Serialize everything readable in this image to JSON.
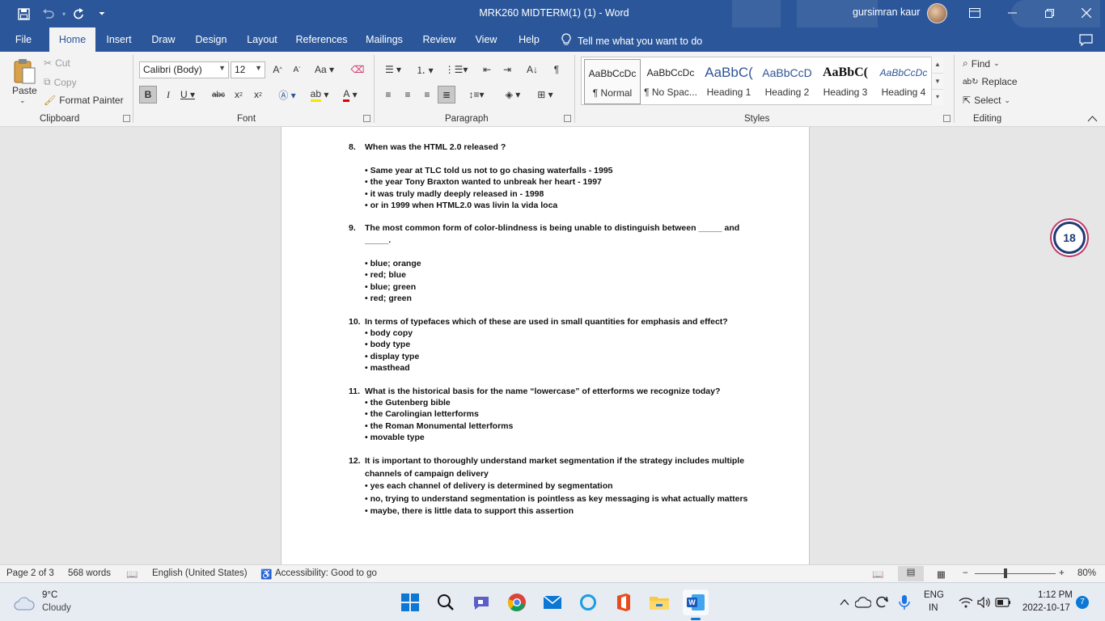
{
  "titlebar": {
    "doc_title": "MRK260 MIDTERM(1) (1)  -  Word",
    "user_name": "gursimran kaur"
  },
  "tabs": [
    "File",
    "Home",
    "Insert",
    "Draw",
    "Design",
    "Layout",
    "References",
    "Mailings",
    "Review",
    "View",
    "Help"
  ],
  "tell_me": "Tell me what you want to do",
  "clipboard": {
    "paste": "Paste",
    "cut": "Cut",
    "copy": "Copy",
    "format_painter": "Format Painter",
    "label": "Clipboard"
  },
  "font": {
    "name": "Calibri (Body)",
    "size": "12",
    "label": "Font"
  },
  "paragraph": {
    "label": "Paragraph"
  },
  "styles": {
    "label": "Styles",
    "items": [
      {
        "preview": "AaBbCcDc",
        "name": "¶ Normal"
      },
      {
        "preview": "AaBbCcDc",
        "name": "¶ No Spac..."
      },
      {
        "preview": "AaBbC(",
        "name": "Heading 1"
      },
      {
        "preview": "AaBbCcD",
        "name": "Heading 2"
      },
      {
        "preview": "AaBbC(",
        "name": "Heading 3"
      },
      {
        "preview": "AaBbCcDc",
        "name": "Heading 4"
      }
    ]
  },
  "editing": {
    "find": "Find",
    "replace": "Replace",
    "select": "Select",
    "label": "Editing"
  },
  "document": {
    "questions": [
      {
        "num": "8.",
        "text": "When was the HTML 2.0 released ?",
        "options": [
          "• Same year at TLC told us not to go chasing waterfalls - 1995",
          "• the year Tony Braxton wanted to unbreak her heart - 1997",
          "• it was truly madly deeply released in - 1998",
          "• or in 1999 when HTML2.0 was livin la vida loca"
        ]
      },
      {
        "num": "9.",
        "text_line1": "The most common form of color-blindness is being unable to distinguish between _____ and",
        "text_line2": "_____.",
        "options": [
          "• blue; orange",
          "• red; blue",
          "• blue; green",
          "• red; green"
        ]
      },
      {
        "num": "10.",
        "text": "In terms of typefaces which of these are used in small quantities for emphasis and effect?",
        "options": [
          "• body copy",
          "• body type",
          "• display type",
          "• masthead"
        ]
      },
      {
        "num": "11.",
        "text": "What is the historical basis for the name “lowercase” of etterforms we recognize today?",
        "options": [
          "• the Gutenberg bible",
          "• the Carolingian letterforms",
          "• the Roman Monumental letterforms",
          "• movable type"
        ]
      },
      {
        "num": "12.",
        "text_line1": "It is important to thoroughly understand market segmentation if the strategy includes multiple",
        "text_line2": "channels of campaign delivery",
        "options": [
          "• yes each channel of delivery is determined by segmentation",
          "• no, trying to understand segmentation is pointless as key messaging is what actually matters",
          "• maybe, there is little data to support this assertion"
        ]
      }
    ]
  },
  "badge": "18",
  "statusbar": {
    "page": "Page 2 of 3",
    "words": "568 words",
    "language": "English (United States)",
    "accessibility": "Accessibility: Good to go",
    "zoom": "80%"
  },
  "taskbar": {
    "temp": "9°C",
    "weather": "Cloudy",
    "lang1": "ENG",
    "lang2": "IN",
    "time": "1:12 PM",
    "date": "2022-10-17",
    "notif": "7"
  }
}
